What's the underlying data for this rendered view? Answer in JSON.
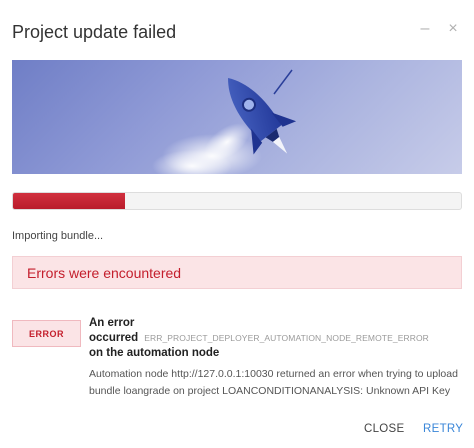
{
  "dialog": {
    "title": "Project update failed",
    "minimize_glyph": "–",
    "close_glyph": "×"
  },
  "hero": {
    "icon": "rocket-illustration",
    "colors": {
      "background": "#8f9ad6",
      "rocket": "#2f4aa8"
    }
  },
  "progress": {
    "fraction": 0.25,
    "color": "#c8252f",
    "status_text": "Importing bundle..."
  },
  "error_banner": {
    "text": "Errors were encountered"
  },
  "error": {
    "badge": "ERROR",
    "title_line1": "An error occurred",
    "title_line2": "on the automation node",
    "code": "ERR_PROJECT_DEPLOYER_AUTOMATION_NODE_REMOTE_ERROR",
    "message_line1": "Automation node http://127.0.0.1:10030 returned an error when trying to upload",
    "message_line2": "bundle loangrade on project LOANCONDITIONANALYSIS: Unknown API Key"
  },
  "footer": {
    "close_label": "CLOSE",
    "retry_label": "RETRY"
  }
}
